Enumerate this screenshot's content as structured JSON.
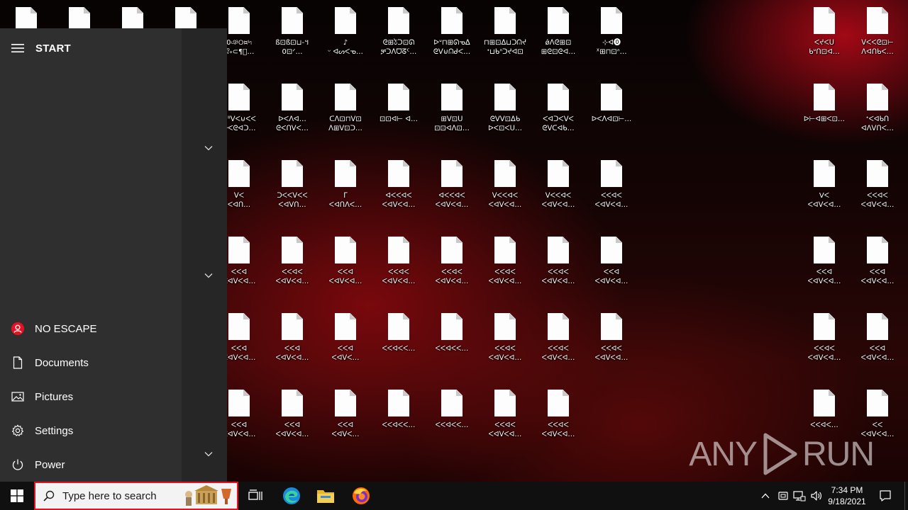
{
  "desktop": {
    "files": [
      {
        "label": ""
      },
      {
        "label": ""
      },
      {
        "label": ""
      },
      {
        "label": ""
      },
      {
        "label": "ີ0ঞ୦¤৸\nঐ৹⊂¶ং…"
      },
      {
        "label": "ß⊡ß⊡⊔-។0⊡ᐟ…"
      },
      {
        "label": "♪\nᵕ ᐊᔕᐸᓀ…"
      },
      {
        "label": "ᘓ⊞ঠᑐ⊡ᘏ\nቻᑐᐱᗜᘔᑦ…"
      },
      {
        "label": "ᐅᐡ⊓⊞ᘏᓀᐃ\nᘓᐯ⊍ᕬᑯᐸ…"
      },
      {
        "label": "⊓⊞⊡ᐃ⊔ᑐᕬᔪ\nᐩ⊔ᑲᐢᑐᔪᐊ⊡"
      },
      {
        "label": "ǿᐱᘓ⊞⊡\n⊞ᘓ⊡ᘓᐊ…"
      },
      {
        "label": "⊹ᐊ⓿\nᕁ⊞⊓⊡ᐢ…"
      },
      {
        "label": "ᐸᔪᐸᑌ\nᑲᐡᑎ⊡ᐊ…"
      },
      {
        "label": "ᐯᐸᐸᘓ⊡⊢\nᐱᐊᑎᑲᐸ…"
      },
      {
        "label": "ᐊᐦᐯᐸ⊍ᐸᐸ\nᐅᐸᘓᐊᑐ…"
      },
      {
        "label": "ᐅᐸᐱᐊ…\nᘓᐸᑎᐯᐸ…"
      },
      {
        "label": "ᑕᐱ⊡⊓ᐯ⊡\nᐱ⊞ᐯ⊡ᑐ…"
      },
      {
        "label": "⊡⊡ᐊ⊢ ᐊ…"
      },
      {
        "label": "⊞ᐯ⊡ᑌ\n⊡⊡ᐊᐱ⊡…"
      },
      {
        "label": "ᘓᐯᐯ⊡ᐃᑲ\nᐅᐸ⊡ᐸᑌ…"
      },
      {
        "label": "ᐸᐊᑐᐸᐯᐸ\nᘓᐯᑕᐊᑲ…"
      },
      {
        "label": "ᐅᐸᐱᐊ⊡⊢…"
      },
      {
        "label": "ᐅ⊢ᐊ⊞ᐸ⊡…"
      },
      {
        "label": "ᐩᐸᐊᑲᑎ\nᐊᐱᐯᑎᐸ…"
      },
      {
        "label": "ᐯᐸ\nᐸᐊᑎ…"
      },
      {
        "label": "ᑐᐸᐸᐯᐸᐸ\nᐸᐊᐯᑎ…"
      },
      {
        "label": "ᒥ\nᐸᐊᑎᐱᐸ…"
      },
      {
        "label": "ᐊᐸᐸᐊᐸ\nᐸᐊᐯᐸᐊ…"
      },
      {
        "label": "ᐊᐸᐸᐊᐸ\nᐸᐊᐯᐸᐊ…"
      },
      {
        "label": "ᐯᐸᐸᐊᐸ\nᐸᐊᐯᐸᐊ…"
      },
      {
        "label": "ᐯᐸᐸᐊᐸ\nᐸᐊᐯᐸᐊ…"
      },
      {
        "label": "ᐸᐸᐊᐸ\nᐸᐊᐯᐸᐊ…"
      },
      {
        "label": "Vᐸ\nᐸᐊᐯᐸᐊ…"
      },
      {
        "label": "ᐸᐸᐊᐸ\nᐸᐊᐯᐸᐊ…"
      },
      {
        "label": "ᐸᐸᐊ\nᐸᐊᐯᐸᐊ…"
      },
      {
        "label": "ᐸᐸᐊᐸ\nᐸᐊᐯᐸᐊ…"
      },
      {
        "label": "ᐸᐸᐊ\nᐸᐊᐯᐸᐊ…"
      },
      {
        "label": "ᐸᐸᐊᐸ\nᐸᐊᐯᐸᐊ…"
      },
      {
        "label": "ᐸᐸᐊᐸ\nᐸᐊᐯᐸᐊ…"
      },
      {
        "label": "ᐸᐸᐊᐸ\nᐸᐊᐯᐸᐊ…"
      },
      {
        "label": "ᐸᐸᐊᐸ\nᐸᐊᐯᐸᐊ…"
      },
      {
        "label": "ᐸᐸᐊ\nᐸᐊᐯᐸᐊ…"
      },
      {
        "label": "ᐸᐸᐊ\nᐸᐊᐯᐸᐊ…"
      },
      {
        "label": "ᐸᐸᐊ\nᐸᐊᐯᐸᐊ…"
      },
      {
        "label": "ᐸᐸᐊ\nᐸᐊᐯᐸᐊ…"
      },
      {
        "label": "ᐸᐸᐊ\nᐸᐊᐯᐸᐊ…"
      },
      {
        "label": "ᐸᐸᐊ\nᐸᐊᐯᐸ…"
      },
      {
        "label": "ᐸᐸᐊᐸᐸ…"
      },
      {
        "label": "ᐸᐸᐊᐸᐸ…"
      },
      {
        "label": "ᐸᐸᐊᐸ\nᐸᐊᐯᐸᐊ…"
      },
      {
        "label": "ᐸᐸᐊᐸ\nᐸᐊᐯᐸᐊ…"
      },
      {
        "label": "ᐸᐸᐊᐸ\nᐸᐊᐯᐸᐊ…"
      },
      {
        "label": "ᐸᐸᐊᐸ\nᐸᐊᐯᐸᐊ…"
      },
      {
        "label": "ᐸᐸᐊ\nᐸᐊᐯᐸᐊ…"
      },
      {
        "label": "ᐸᐸᐊ\nᐸᐊᐯᐸᐊ…"
      },
      {
        "label": "ᐸᐸᐊ\nᐸᐊᐯᐸᐊ…"
      },
      {
        "label": "ᐸᐸᐊ\nᐸᐊᐯᐸ…"
      },
      {
        "label": "ᐸᐸᐊᐸᐸ…"
      },
      {
        "label": "ᐸᐸᐊᐸᐸ…"
      },
      {
        "label": "ᐸᐸᐊᐸ\nᐸᐊᐯᐸᐊ…"
      },
      {
        "label": "ᐸᐸᐊᐸ\nᐸᐊᐯᐸᐊ…"
      },
      {
        "label": "ᐸᐸᐊᐸ…"
      },
      {
        "label": "ᐸᐸ\nᐸᐊᐯᐸᐊ…"
      },
      {
        "label": "ᐸᐸᐊ\nᐸᐊᐯᐸᐊ…"
      },
      {
        "label": "ᐸᐸᐊ\nᐸᐊᐯᐸᐊ…"
      }
    ],
    "watermark": "ANY RUN"
  },
  "start_menu": {
    "title": "START",
    "items": [
      {
        "label": "NO ESCAPE",
        "icon": "user-avatar-icon"
      },
      {
        "label": "Documents",
        "icon": "document-icon"
      },
      {
        "label": "Pictures",
        "icon": "pictures-icon"
      },
      {
        "label": "Settings",
        "icon": "gear-icon"
      },
      {
        "label": "Power",
        "icon": "power-icon"
      }
    ]
  },
  "taskbar": {
    "search_placeholder": "Type here to search",
    "clock_time": "7:34 PM",
    "clock_date": "9/18/2021"
  },
  "colors": {
    "accent_red": "#e81123",
    "start_bg": "#2f2f2f",
    "taskbar_bg": "#101010"
  }
}
